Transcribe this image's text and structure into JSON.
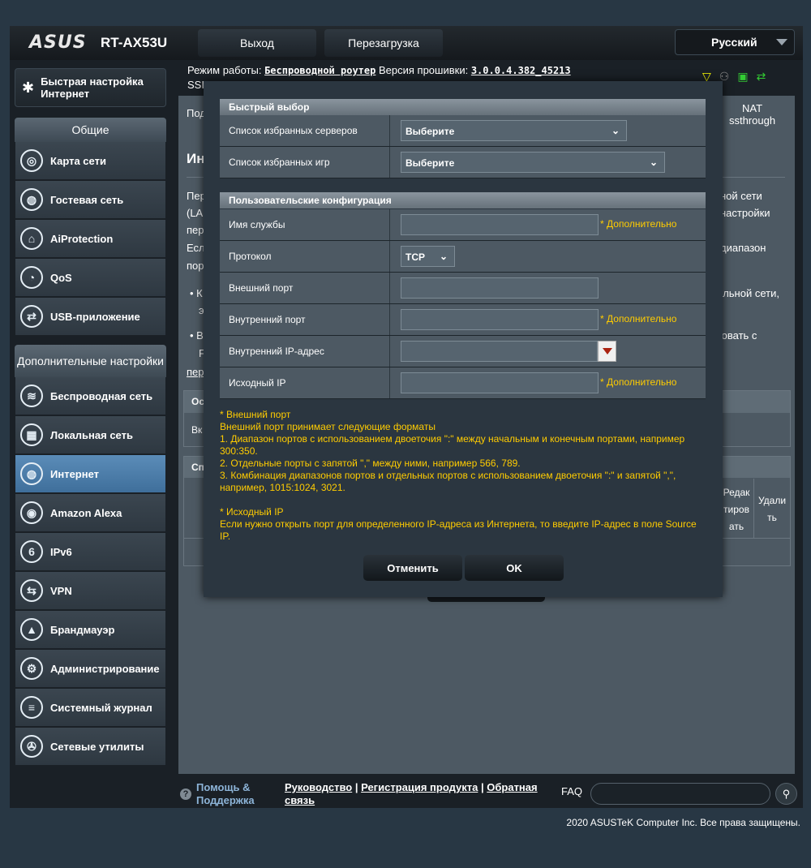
{
  "header": {
    "brand": "ASUS",
    "model": "RT-AX53U",
    "logout_label": "Выход",
    "reboot_label": "Перезагрузка",
    "language": "Русский",
    "mode_prefix": "Режим работы:",
    "mode_value": "Беспроводной роутер",
    "fw_prefix": "Версия прошивки:",
    "fw_value": "3.0.0.4.382_45213",
    "ssid_prefix": "SSI"
  },
  "sidebar": {
    "quick_setup": "Быстрая настройка Интернет",
    "general_header": "Общие",
    "general_items": [
      {
        "label": "Карта сети",
        "icon": "globe-network-icon"
      },
      {
        "label": "Гостевая сеть",
        "icon": "guest-network-icon"
      },
      {
        "label": "AiProtection",
        "icon": "lock-shield-icon"
      },
      {
        "label": "QoS",
        "icon": "gauge-icon"
      },
      {
        "label": "USB-приложение",
        "icon": "usb-icon"
      }
    ],
    "advanced_header": "Дополнительные настройки",
    "advanced_items": [
      {
        "label": "Беспроводная сеть",
        "icon": "wifi-icon"
      },
      {
        "label": "Локальная сеть",
        "icon": "lan-icon"
      },
      {
        "label": "Интернет",
        "icon": "globe-icon",
        "active": true
      },
      {
        "label": "Amazon Alexa",
        "icon": "alexa-icon"
      },
      {
        "label": "IPv6",
        "icon": "ipv6-icon"
      },
      {
        "label": "VPN",
        "icon": "vpn-icon"
      },
      {
        "label": "Брандмауэр",
        "icon": "firewall-icon"
      },
      {
        "label": "Администрирование",
        "icon": "admin-icon"
      },
      {
        "label": "Системный журнал",
        "icon": "log-icon"
      },
      {
        "label": "Сетевые утилиты",
        "icon": "tools-icon"
      }
    ]
  },
  "main": {
    "tab_active": "Под",
    "tab_nat_line1": "NAT",
    "tab_nat_line2": "ssthrough",
    "title_fragment": "Ин",
    "bg_left": [
      "Пер",
      "(LA",
      "пер",
      "Есл",
      "пор"
    ],
    "bg_right": [
      "ной сети",
      "настройки",
      "",
      "диапазон"
    ],
    "bullet1_left": "К",
    "bullet1_left2": "э",
    "bullet1_right": "кальной сети,",
    "bullet2_left": "В",
    "bullet2_left2": "F",
    "bullet2_right": "ктовать с",
    "link_fragment": "пер",
    "table1_head": "Ос",
    "table1_cell": "Вк",
    "table2_head": "Сп",
    "col_edit": "Редак тиров ать",
    "col_delete": "Удали ть"
  },
  "modal": {
    "quick_header": "Быстрый выбор",
    "fav_servers_label": "Список избранных серверов",
    "fav_servers_value": "Выберите",
    "fav_games_label": "Список избранных игр",
    "fav_games_value": "Выберите",
    "user_header": "Пользовательские конфигурация",
    "service_name_label": "Имя службы",
    "protocol_label": "Протокол",
    "protocol_value": "TCP",
    "external_port_label": "Внешний порт",
    "internal_port_label": "Внутренний порт",
    "internal_ip_label": "Внутренний IP-адрес",
    "source_ip_label": "Исходный IP",
    "optional": "* Дополнительно",
    "notes": [
      "* Внешний порт",
      "Внешний порт принимает следующие форматы",
      "1. Диапазон портов с использованием двоеточия \":\" между начальным и конечным портами, например 300:350.",
      "2. Отдельные порты с запятой \",\" между ними, например 566, 789.",
      "3. Комбинация диапазонов портов и отдельных портов с использованием двоеточия \":\" и запятой \",\", например, 1015:1024, 3021.",
      "",
      "* Исходный IP",
      "Если нужно открыть порт для определенного IP-адреса из Интернета, то введите IP-адрес в поле Source IP."
    ],
    "cancel_label": "Отменить",
    "ok_label": "OK"
  },
  "footer": {
    "help": "Помощь & Поддержка",
    "link_manual": "Руководство",
    "link_register": "Регистрация продукта",
    "link_feedback": "Обратная связь",
    "sep": "|",
    "faq": "FAQ",
    "copyright": "2020 ASUSTeK Computer Inc. Все права защищены."
  }
}
